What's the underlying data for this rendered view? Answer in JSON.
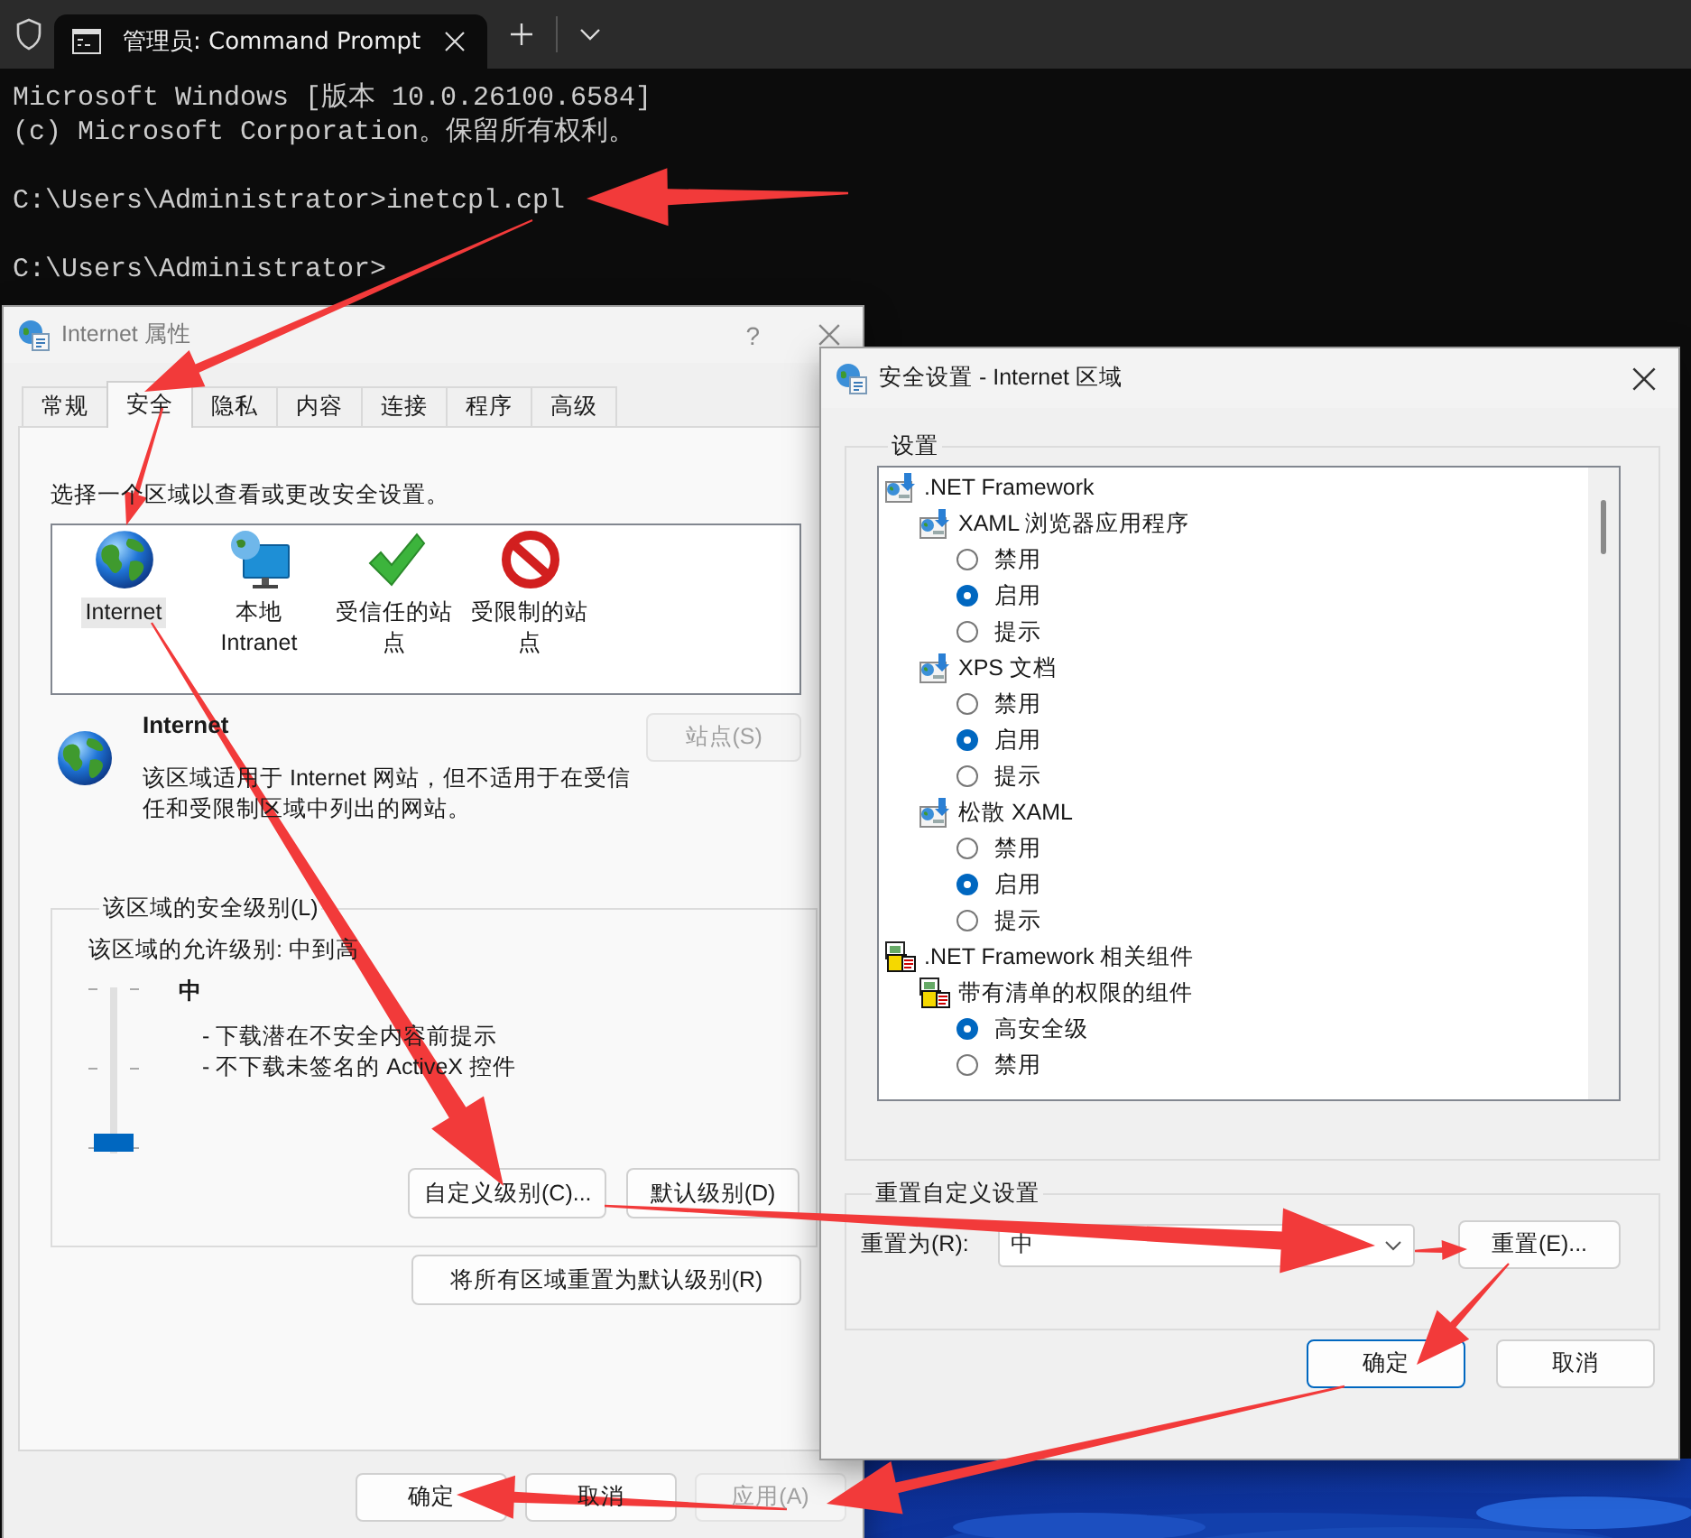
{
  "terminal": {
    "tab_title": "管理员: Command Prompt",
    "blocks": [
      [
        "Microsoft Windows [版本 10.0.26100.6584]",
        "(c) Microsoft Corporation。保留所有权利。"
      ],
      [
        "C:\\Users\\Administrator>inetcpl.cpl"
      ],
      [
        "C:\\Users\\Administrator>"
      ]
    ]
  },
  "internet_options": {
    "title": "Internet 属性",
    "help": "?",
    "tabs": [
      {
        "label": "常规",
        "selected": false
      },
      {
        "label": "安全",
        "selected": true
      },
      {
        "label": "隐私",
        "selected": false
      },
      {
        "label": "内容",
        "selected": false
      },
      {
        "label": "连接",
        "selected": false
      },
      {
        "label": "程序",
        "selected": false
      },
      {
        "label": "高级",
        "selected": false
      }
    ],
    "zone_prompt": "选择一个区域以查看或更改安全设置。",
    "zones": [
      {
        "kind": "internet",
        "label": "Internet",
        "selected": true
      },
      {
        "kind": "intranet",
        "label": "本地 Intranet",
        "selected": false
      },
      {
        "kind": "trusted",
        "label": "受信任的站点",
        "selected": false
      },
      {
        "kind": "restricted",
        "label": "受限制的站点",
        "selected": false
      }
    ],
    "zone_info": {
      "title": "Internet",
      "description": "该区域适用于 Internet 网站，但不适用于在受信任和受限制区域中列出的网站。",
      "sites_button": {
        "label": "站点(S)",
        "disabled": true
      }
    },
    "security_level": {
      "legend": "该区域的安全级别(L)",
      "allowed": "该区域的允许级别: 中到高",
      "level": 0,
      "level_name": "中",
      "bullets": [
        "- 下载潜在不安全内容前提示",
        "- 不下载未签名的 ActiveX 控件"
      ],
      "buttons": [
        {
          "label": "自定义级别(C)...",
          "disabled": false
        },
        {
          "label": "默认级别(D)",
          "disabled": false
        }
      ]
    },
    "reset_all_button": "将所有区域重置为默认级别(R)",
    "footer_buttons": [
      {
        "label": "确定",
        "disabled": false
      },
      {
        "label": "取消",
        "disabled": false
      },
      {
        "label": "应用(A)",
        "disabled": true
      }
    ]
  },
  "security_settings": {
    "title": "安全设置 - Internet 区域",
    "settings_legend": "设置",
    "tree": [
      {
        "kind": "setting",
        "label": ".NET Framework",
        "children": [
          {
            "kind": "setting",
            "label": "XAML 浏览器应用程序",
            "children": [
              {
                "kind": "option",
                "label": "禁用",
                "selected": false
              },
              {
                "kind": "option",
                "label": "启用",
                "selected": true
              },
              {
                "kind": "option",
                "label": "提示",
                "selected": false
              }
            ]
          },
          {
            "kind": "setting",
            "label": "XPS 文档",
            "children": [
              {
                "kind": "option",
                "label": "禁用",
                "selected": false
              },
              {
                "kind": "option",
                "label": "启用",
                "selected": true
              },
              {
                "kind": "option",
                "label": "提示",
                "selected": false
              }
            ]
          },
          {
            "kind": "setting",
            "label": "松散 XAML",
            "children": [
              {
                "kind": "option",
                "label": "禁用",
                "selected": false
              },
              {
                "kind": "option",
                "label": "启用",
                "selected": true
              },
              {
                "kind": "option",
                "label": "提示",
                "selected": false
              }
            ]
          }
        ]
      },
      {
        "kind": "component",
        "label": ".NET Framework 相关组件",
        "children": [
          {
            "kind": "component",
            "label": "带有清单的权限的组件",
            "children": [
              {
                "kind": "option",
                "label": "高安全级",
                "selected": true
              },
              {
                "kind": "option",
                "label": "禁用",
                "selected": false
              }
            ]
          }
        ]
      }
    ],
    "reset_group": {
      "legend": "重置自定义设置",
      "label": "重置为(R):",
      "value": "中",
      "button": "重置(E)..."
    },
    "buttons": [
      {
        "label": "确定",
        "default": true
      },
      {
        "label": "取消",
        "default": false
      }
    ]
  }
}
